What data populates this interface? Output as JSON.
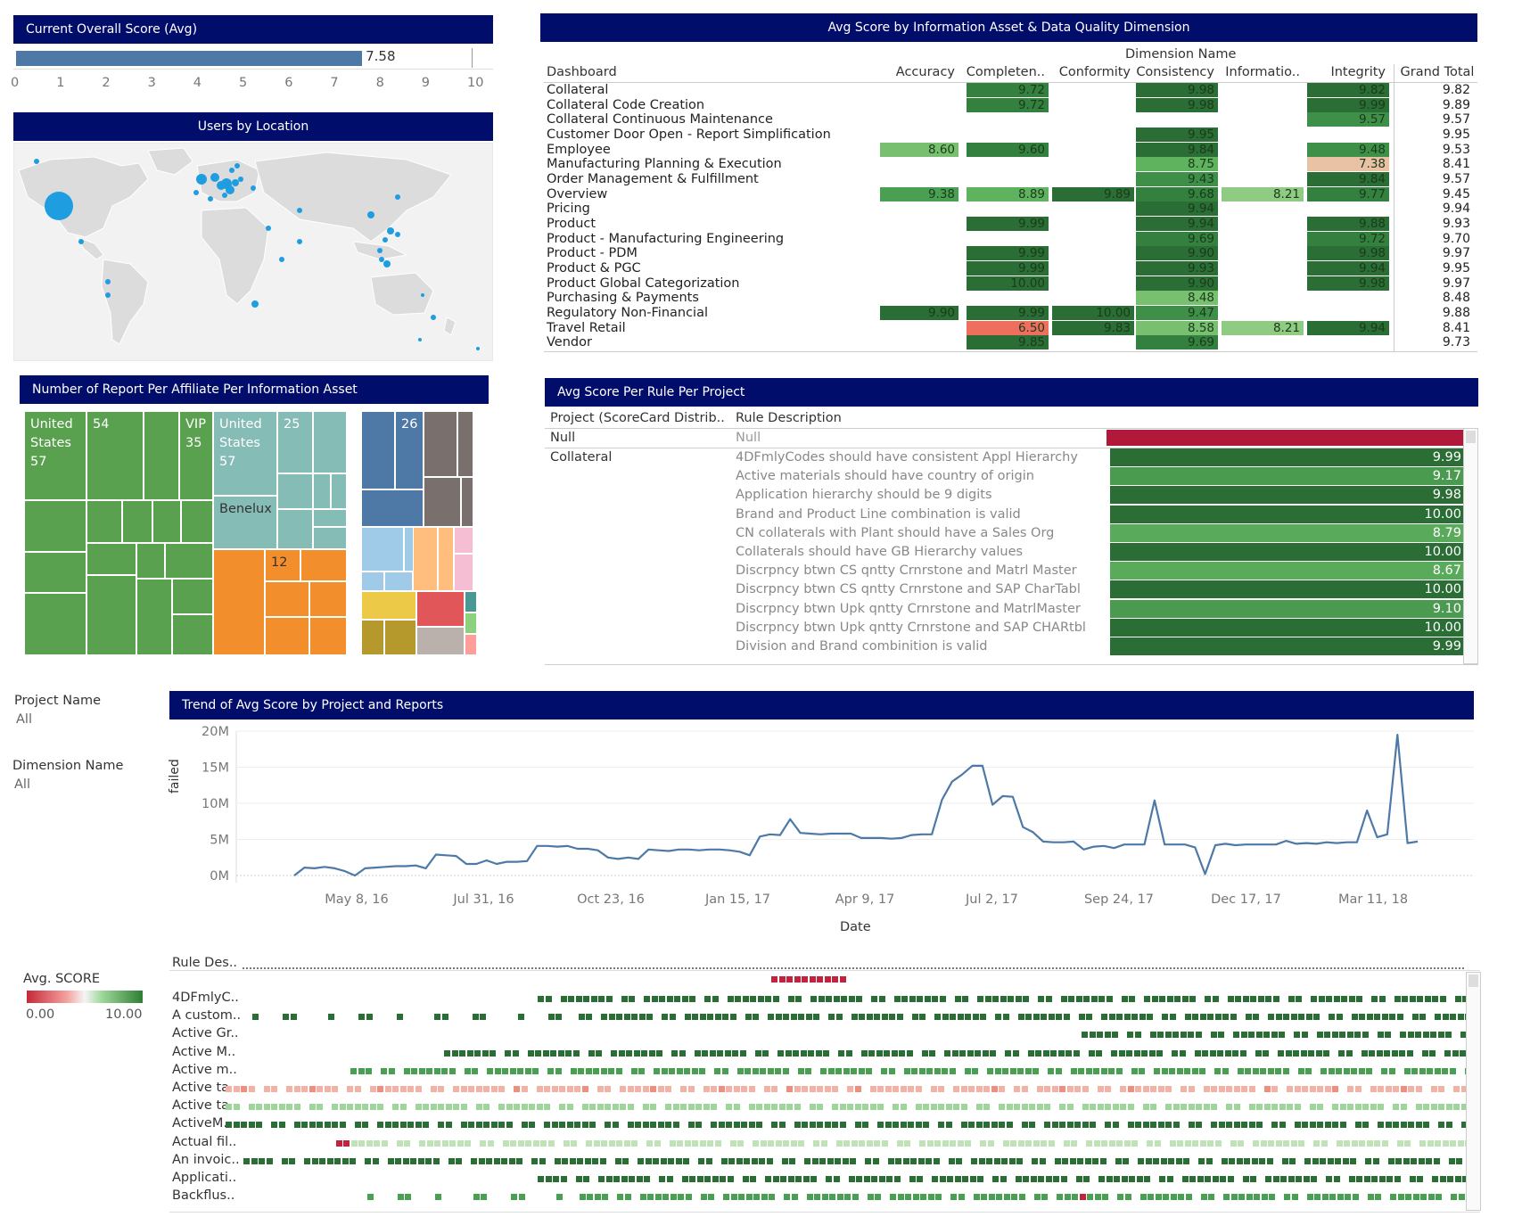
{
  "overall": {
    "title": "Current Overall Score (Avg)",
    "value": 7.58,
    "value_label": "7.58",
    "axis_ticks": [
      "0",
      "1",
      "2",
      "3",
      "4",
      "5",
      "6",
      "7",
      "8",
      "9",
      "10"
    ],
    "max": 10
  },
  "users": {
    "title": "Users by Location"
  },
  "heatmap": {
    "title": "Avg Score by Information Asset & Data Quality Dimension",
    "group_header": "Dimension Name",
    "row_header": "Dashboard",
    "columns": [
      "Accuracy",
      "Completen..",
      "Conformity",
      "Consistency",
      "Informatio..",
      "Integrity",
      "Grand Total"
    ],
    "rows": [
      {
        "label": "Collateral",
        "cells": [
          null,
          "9.72",
          null,
          "9.98",
          null,
          "9.82"
        ],
        "total": "9.82"
      },
      {
        "label": "Collateral Code Creation",
        "cells": [
          null,
          "9.72",
          null,
          "9.98",
          null,
          "9.99"
        ],
        "total": "9.89"
      },
      {
        "label": "Collateral Continuous Maintenance",
        "cells": [
          null,
          null,
          null,
          null,
          null,
          "9.57"
        ],
        "total": "9.57"
      },
      {
        "label": "Customer Door Open - Report Simplification",
        "cells": [
          null,
          null,
          null,
          "9.95",
          null,
          null
        ],
        "total": "9.95"
      },
      {
        "label": "Employee",
        "cells": [
          "8.60",
          "9.60",
          null,
          "9.84",
          null,
          "9.48"
        ],
        "total": "9.53"
      },
      {
        "label": "Manufacturing Planning & Execution",
        "cells": [
          null,
          null,
          null,
          "8.75",
          null,
          "7.38"
        ],
        "total": "8.41"
      },
      {
        "label": "Order Management & Fulfillment",
        "cells": [
          null,
          null,
          null,
          "9.43",
          null,
          "9.84"
        ],
        "total": "9.57"
      },
      {
        "label": "Overview",
        "cells": [
          "9.38",
          "8.89",
          "9.89",
          "9.68",
          "8.21",
          "9.77"
        ],
        "total": "9.45"
      },
      {
        "label": "Pricing",
        "cells": [
          null,
          null,
          null,
          "9.94",
          null,
          null
        ],
        "total": "9.94"
      },
      {
        "label": "Product",
        "cells": [
          null,
          "9.99",
          null,
          "9.94",
          null,
          "9.88"
        ],
        "total": "9.93"
      },
      {
        "label": "Product - Manufacturing Engineering",
        "cells": [
          null,
          null,
          null,
          "9.69",
          null,
          "9.72"
        ],
        "total": "9.70"
      },
      {
        "label": "Product - PDM",
        "cells": [
          null,
          "9.99",
          null,
          "9.90",
          null,
          "9.98"
        ],
        "total": "9.97"
      },
      {
        "label": "Product & PGC",
        "cells": [
          null,
          "9.99",
          null,
          "9.93",
          null,
          "9.94"
        ],
        "total": "9.95"
      },
      {
        "label": "Product Global Categorization",
        "cells": [
          null,
          "10.00",
          null,
          "9.90",
          null,
          "9.98"
        ],
        "total": "9.97"
      },
      {
        "label": "Purchasing & Payments",
        "cells": [
          null,
          null,
          null,
          "8.48",
          null,
          null
        ],
        "total": "8.48"
      },
      {
        "label": "Regulatory Non-Financial",
        "cells": [
          "9.90",
          "9.99",
          "10.00",
          "9.47",
          null,
          null
        ],
        "total": "9.88"
      },
      {
        "label": "Travel Retail",
        "cells": [
          null,
          "6.50",
          "9.83",
          "8.58",
          "8.21",
          "9.94"
        ],
        "total": "8.41"
      },
      {
        "label": "Vendor",
        "cells": [
          null,
          "9.85",
          null,
          "9.69",
          null,
          null
        ],
        "total": "9.73"
      }
    ]
  },
  "treemap": {
    "title": "Number of Report Per Affiliate Per Information Asset",
    "labels": {
      "us1": "United States",
      "us1_v": "57",
      "g54": "54",
      "vip": "VIP",
      "vip_v": "35",
      "us2": "United States",
      "us2_v": "57",
      "t25": "25",
      "benelux": "Benelux",
      "b26": "26",
      "o12": "12"
    }
  },
  "rules": {
    "title": "Avg Score Per Rule Per Project",
    "col1": "Project (ScoreCard Distrib..",
    "col2": "Rule Description",
    "null_project": "Null",
    "null_desc": "Null",
    "project": "Collateral",
    "items": [
      {
        "desc": "4DFmlyCodes should have consistent Appl Hierarchy",
        "score": "9.99"
      },
      {
        "desc": "Active materials should have country of origin",
        "score": "9.17"
      },
      {
        "desc": "Application hierarchy should be 9 digits",
        "score": "9.98"
      },
      {
        "desc": "Brand and Product Line combination is valid",
        "score": "10.00"
      },
      {
        "desc": "CN collaterals with Plant should have a Sales Org",
        "score": "8.79"
      },
      {
        "desc": "Collaterals should have GB Hierarchy values",
        "score": "10.00"
      },
      {
        "desc": "Discrpncy btwn CS qntty Crnrstone and Matrl Master",
        "score": "8.67"
      },
      {
        "desc": "Discrpncy btwn CS qntty Crnrstone and SAP CharTabl",
        "score": "10.00"
      },
      {
        "desc": "Discrpncy btwn Upk qntty Crnrstone and MatrlMaster",
        "score": "9.10"
      },
      {
        "desc": "Discrpncy btwn Upk qntty Crnrstone and SAP CHARtbl",
        "score": "10.00"
      },
      {
        "desc": "Division and Brand combinition is valid",
        "score": "9.99"
      }
    ]
  },
  "filters": {
    "project_label": "Project Name",
    "project_value": "All",
    "dimension_label": "Dimension Name",
    "dimension_value": "All"
  },
  "trend": {
    "title": "Trend of  Avg Score by Project and Reports",
    "ylabel": "failed",
    "xlabel": "Date"
  },
  "chart_data": {
    "type": "line",
    "title": "Trend of  Avg Score by Project and Reports",
    "xlabel": "Date",
    "ylabel": "failed",
    "ylim": [
      0,
      20000000
    ],
    "y_ticks": [
      "0M",
      "5M",
      "10M",
      "15M",
      "20M"
    ],
    "x_ticks": [
      "May 8, 16",
      "Jul 31, 16",
      "Oct 23, 16",
      "Jan 15, 17",
      "Apr 9, 17",
      "Jul 2, 17",
      "Sep 24, 17",
      "Dec 17, 17",
      "Mar 11, 18"
    ],
    "series": [
      {
        "values": [
          0.0,
          1.1,
          1.0,
          1.2,
          1.0,
          0.6,
          0.0,
          1.0,
          1.1,
          1.2,
          1.3,
          1.3,
          1.4,
          1.0,
          2.9,
          2.8,
          2.7,
          1.6,
          1.6,
          2.1,
          1.6,
          1.9,
          1.9,
          2.0,
          4.1,
          4.1,
          4.0,
          4.1,
          3.7,
          3.7,
          3.5,
          2.5,
          2.3,
          2.5,
          2.3,
          3.6,
          3.5,
          3.4,
          3.6,
          3.6,
          3.5,
          3.6,
          3.6,
          3.5,
          3.3,
          2.8,
          5.4,
          5.7,
          5.6,
          7.8,
          5.9,
          5.8,
          5.7,
          5.8,
          5.8,
          5.8,
          5.2,
          5.2,
          5.2,
          5.1,
          5.2,
          5.6,
          5.7,
          5.7,
          10.5,
          13.0,
          14.0,
          15.2,
          15.2,
          9.8,
          11.0,
          10.9,
          6.7,
          6.0,
          4.7,
          4.6,
          4.6,
          4.7,
          3.6,
          4.0,
          4.1,
          3.8,
          4.3,
          4.3,
          4.3,
          10.4,
          4.3,
          4.3,
          4.3,
          3.9,
          0.2,
          4.2,
          4.4,
          4.2,
          4.3,
          4.3,
          4.3,
          4.3,
          4.8,
          4.4,
          4.5,
          4.4,
          4.6,
          4.5,
          4.6,
          4.6,
          9.0,
          5.3,
          5.7,
          19.5,
          4.5,
          4.7
        ]
      }
    ]
  },
  "dots": {
    "header": "Rule Des..",
    "legend_title": "Avg. SCORE",
    "legend_min": "0.00",
    "legend_max": "10.00",
    "rows": [
      "4DFmlyC..",
      "A custom..",
      "Active Gr..",
      "Active M..",
      "Active m..",
      "Active ta..",
      "Active ta..",
      "ActiveM..",
      "Actual fil..",
      "An invoic..",
      "Applicati..",
      "Backflus.."
    ]
  },
  "colors": {
    "title_bg": "#000d6b",
    "bar": "#4e79a7",
    "line": "#4e79a7",
    "dark_green": "#2e7d32",
    "mid_green": "#4caf50",
    "light_green": "#81c784",
    "salmon": "#f08070",
    "red": "#c62838"
  }
}
